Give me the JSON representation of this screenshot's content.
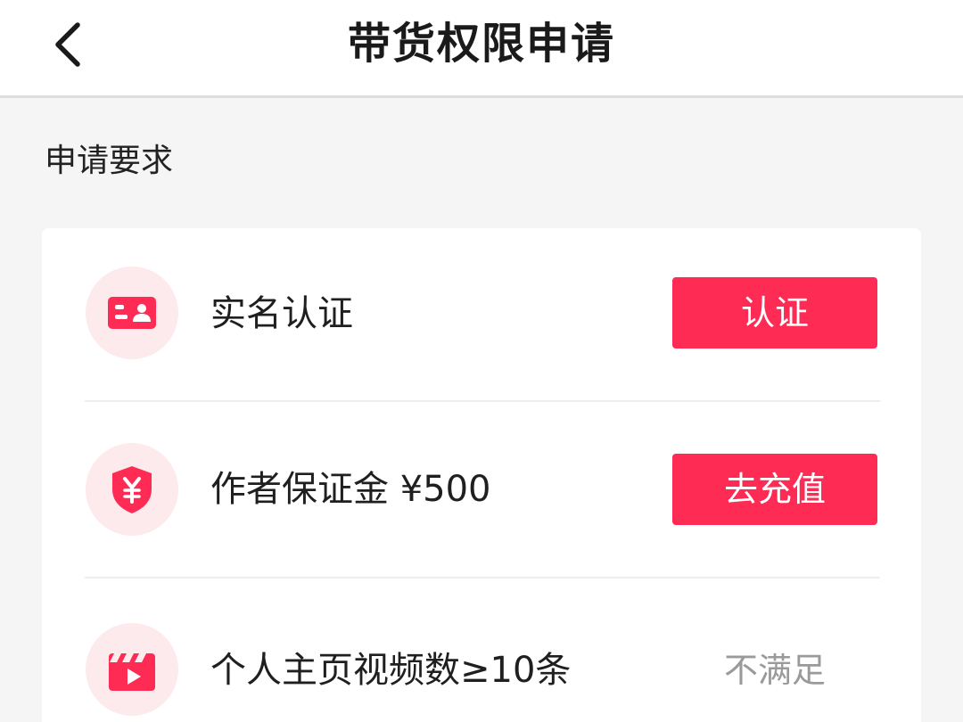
{
  "header": {
    "title": "带货权限申请",
    "back_icon": "chevron-left-icon"
  },
  "section": {
    "title": "申请要求"
  },
  "requirements": [
    {
      "icon": "id-card-icon",
      "label": "实名认证",
      "action": "认证",
      "kind": "button"
    },
    {
      "icon": "shield-yen-icon",
      "label": "作者保证金 ¥500",
      "action": "去充值",
      "kind": "button"
    },
    {
      "icon": "video-clapper-icon",
      "label": "个人主页视频数≥10条",
      "status": "不满足",
      "kind": "status"
    }
  ],
  "colors": {
    "accent": "#fe2c55",
    "icon_bg": "#fdeaec",
    "muted_text": "#9a9a9a"
  }
}
